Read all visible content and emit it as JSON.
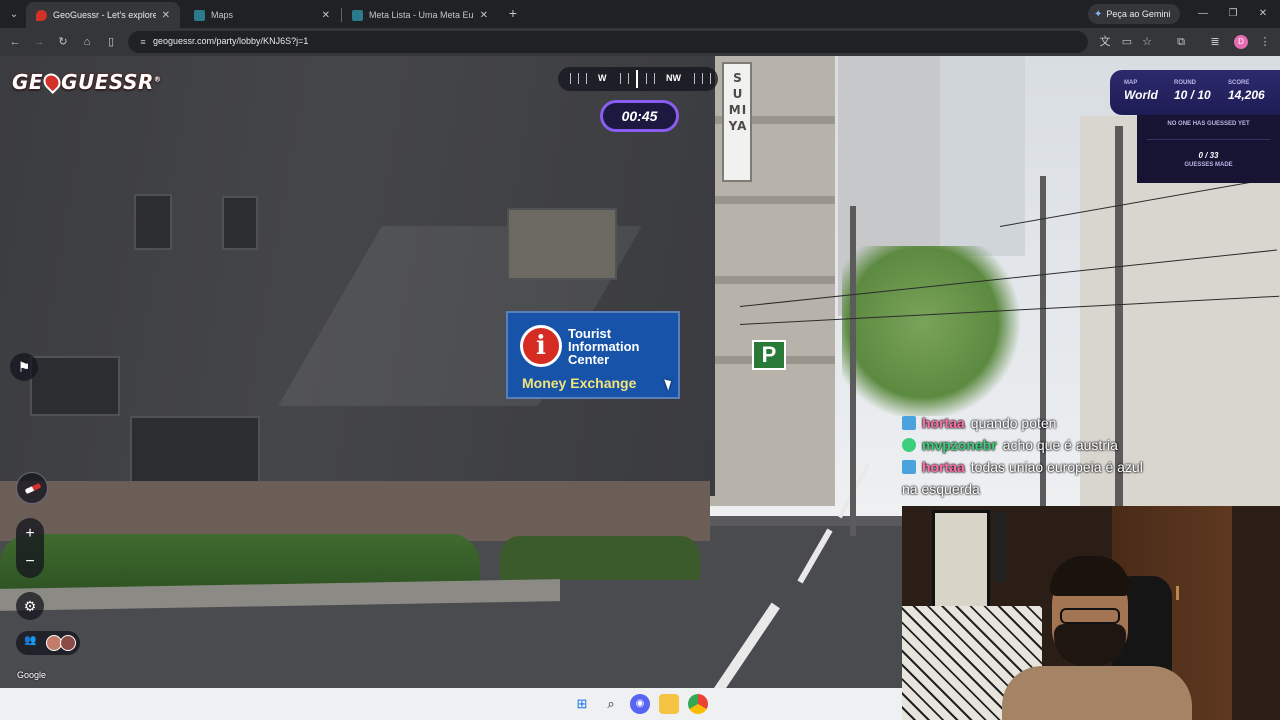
{
  "browser": {
    "tabs": [
      {
        "title": "GeoGuessr - Let's explore the w",
        "active": true
      },
      {
        "title": "Maps",
        "active": false
      },
      {
        "title": "Meta Lista - Uma Meta Europa",
        "active": false
      }
    ],
    "gemini_label": "Peça ao Gemini",
    "url": "geoguessr.com/party/lobby/KNJ6S?j=1",
    "profile_initial": "D"
  },
  "game": {
    "logo": "GEOGUESSR",
    "compass": {
      "left_label": "W",
      "right_label": "NW"
    },
    "timer": "00:45",
    "map_label": "MAP",
    "map_value": "World",
    "round_label": "ROUND",
    "round_value": "10 / 10",
    "score_label": "SCORE",
    "score_value": "14,206",
    "no_guess_text": "NO ONE HAS GUESSED YET",
    "guesses_count": "0 / 33",
    "guesses_caption": "GUESSES MADE",
    "attribution": "Google"
  },
  "scene_signs": {
    "sumiya": "SUMIYA",
    "tic_line": "Tourist Information Center",
    "money_exchange": "Money Exchange",
    "parking": "P"
  },
  "chat": [
    {
      "user": "hortaa",
      "text": "quando poten",
      "user_color": "#ff6fa8",
      "badge_color": "#4aa3df"
    },
    {
      "user": "mvpzonebr",
      "text": "acho que é austria",
      "user_color": "#3ad07b",
      "badge_color": "#3ad07b"
    },
    {
      "user": "hortaa",
      "text": "todas uniao europeia é azul na esquerda",
      "user_color": "#ff6fa8",
      "badge_color": "#4aa3df"
    }
  ],
  "colors": {
    "gg_accent": "#8a5df0",
    "gg_panel": "#1e1c55",
    "tic_blue": "#1653a9",
    "taskbar": "#eff0f2"
  },
  "taskbar_icons": [
    "windows-start-icon",
    "search-icon",
    "discord-icon",
    "file-explorer-icon",
    "chrome-icon"
  ]
}
